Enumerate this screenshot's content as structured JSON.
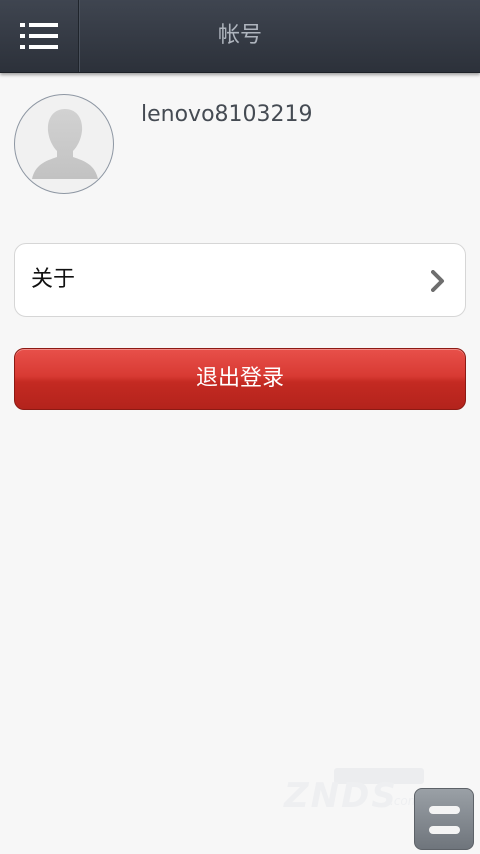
{
  "header": {
    "title": "帐号",
    "menu_icon": "menu-icon"
  },
  "profile": {
    "avatar_icon": "default-avatar-icon",
    "username": "lenovo8103219"
  },
  "settings": {
    "about_label": "关于",
    "about_chevron_icon": "chevron-right-icon"
  },
  "actions": {
    "logout_label": "退出登录",
    "logout_color": "#d0342c"
  },
  "floating": {
    "icon": "collapse-menu-icon"
  },
  "colors": {
    "header_bg": "#343942",
    "page_bg": "#f7f7f7",
    "title_text": "#aeb4bd"
  }
}
